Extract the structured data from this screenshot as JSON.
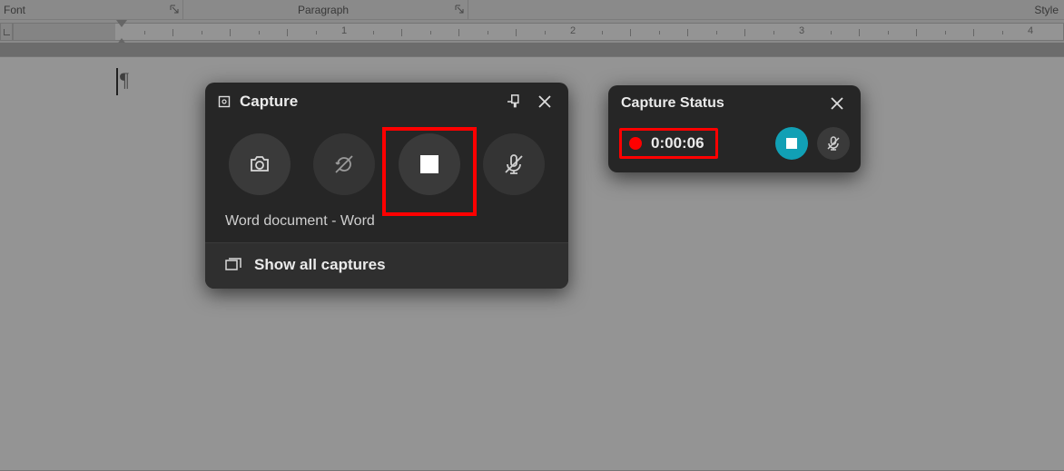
{
  "ribbon": {
    "font_label": "Font",
    "paragraph_label": "Paragraph",
    "style_label": "Style"
  },
  "ruler": {
    "numbers": [
      "1",
      "2",
      "3",
      "4"
    ]
  },
  "document": {
    "pilcrow": "¶",
    "target_name": "Word document - Word"
  },
  "capture_panel": {
    "title": "Capture",
    "screenshot_icon": "camera-icon",
    "recapture_icon": "refresh-slash-icon",
    "stop_icon": "stop-icon",
    "mic_icon": "microphone-muted-icon",
    "show_all_label": "Show all captures"
  },
  "status_panel": {
    "title": "Capture Status",
    "timer": "0:00:06"
  }
}
